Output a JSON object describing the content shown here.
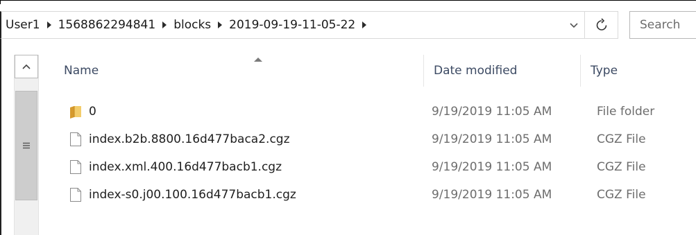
{
  "address_bar": {
    "crumbs": [
      "User1",
      "1568862294841",
      "blocks",
      "2019-09-19-11-05-22"
    ]
  },
  "search": {
    "placeholder": "Search"
  },
  "columns": {
    "name": "Name",
    "date_modified": "Date modified",
    "type": "Type"
  },
  "files": [
    {
      "name": "0",
      "date": "9/19/2019 11:05 AM",
      "type": "File folder",
      "icon": "folder-icon"
    },
    {
      "name": "index.b2b.8800.16d477baca2.cgz",
      "date": "9/19/2019 11:05 AM",
      "type": "CGZ File",
      "icon": "file-icon"
    },
    {
      "name": "index.xml.400.16d477bacb1.cgz",
      "date": "9/19/2019 11:05 AM",
      "type": "CGZ File",
      "icon": "file-icon"
    },
    {
      "name": "index-s0.j00.100.16d477bacb1.cgz",
      "date": "9/19/2019 11:05 AM",
      "type": "CGZ File",
      "icon": "file-icon"
    }
  ],
  "colors": {
    "header_text": "#3c4a63",
    "folder": "#e8b84a",
    "secondary_text": "#6d6d6d"
  }
}
